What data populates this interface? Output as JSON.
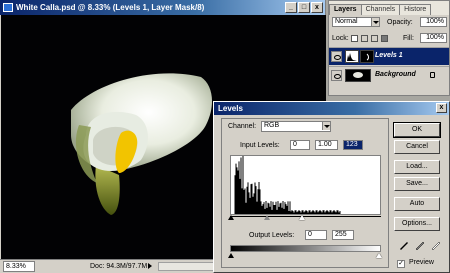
{
  "document_window": {
    "title": "White Calla.psd @ 8.33% (Levels 1, Layer Mask/8)",
    "minimize_glyph": "_",
    "maximize_glyph": "□",
    "close_glyph": "x",
    "zoom": "8.33%",
    "doc_size": "Doc: 94.3M/97.7M"
  },
  "layers_palette": {
    "tabs": [
      "Layers",
      "Channels",
      "Histore"
    ],
    "blend_mode": "Normal",
    "opacity_label": "Opacity:",
    "opacity_value": "100%",
    "lock_label": "Lock:",
    "fill_label": "Fill:",
    "fill_value": "100%",
    "layers": [
      {
        "name": "Levels 1",
        "selected": true
      },
      {
        "name": "Background",
        "selected": false
      }
    ]
  },
  "levels_dialog": {
    "title": "Levels",
    "close_glyph": "x",
    "channel_label": "Channel:",
    "channel_value": "RGB",
    "input_levels_label": "Input Levels:",
    "input_levels": [
      "0",
      "1.00",
      "123"
    ],
    "output_levels_label": "Output Levels:",
    "output_levels": [
      "0",
      "255"
    ],
    "buttons": {
      "ok": "OK",
      "cancel": "Cancel",
      "load": "Load...",
      "save": "Save...",
      "auto": "Auto",
      "options": "Options..."
    },
    "preview_label": "Preview",
    "preview_checked": true,
    "histogram_shape": "dark-heavy"
  },
  "colors": {
    "title_blue": "#0a246a",
    "selection_blue": "#0a246a",
    "dialog_grey": "#d4d0c8",
    "flower_yellow": "#f2c400"
  }
}
